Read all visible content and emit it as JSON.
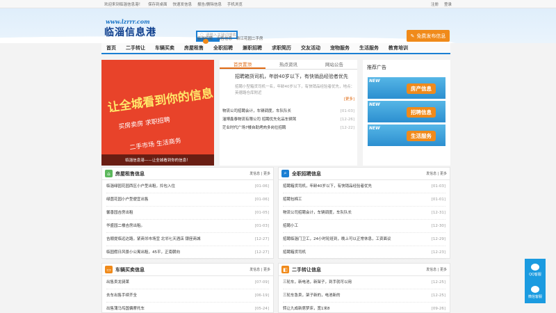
{
  "topbar": {
    "welcome": "欢迎来到临淄信息港！",
    "links": [
      "保存到桌面",
      "快速发信息",
      "报告/删除信息",
      "手机浏览"
    ],
    "right": [
      "注册",
      "登录"
    ]
  },
  "logo": {
    "url": "www.lzrrr.com",
    "name": "临淄信息港"
  },
  "search": {
    "placeholder": "请输入关键词搜索",
    "button": "搜索"
  },
  "hotlinks": [
    "临淄招聘",
    "出售信息",
    "新江花园二手房"
  ],
  "post_button": "免费发布信息",
  "nav": [
    "首页",
    "二手转让",
    "车辆买卖",
    "房屋租售",
    "全职招聘",
    "兼职招聘",
    "求职简历",
    "交友活动",
    "宠物服务",
    "生活服务",
    "教育培训"
  ],
  "banner": {
    "big": "让全城看到你的信息",
    "line1": "买房卖房  求职招聘",
    "line2": "二手市场  生活商务",
    "caption": "临淄信息港——让全城看到你的信息！"
  },
  "center": {
    "tabs": [
      "首页置顶",
      "热点资讯",
      "网站公告"
    ],
    "lead_title": "招聘箱货司机，年龄40岁以下，有快销品经验者优先",
    "lead_desc": "招聘小型箱货司机一名，年龄40岁以下，有快销品经验者优先，地点：英德路仓库附近",
    "more": "[更多]",
    "list": [
      {
        "title": "物流公司招聘会计，车辆调度，车队队长",
        "date": "[01-03]"
      },
      {
        "title": "淄博鑫泰物流有限公司 招聘优先化品车辆驾",
        "date": "[12-26]"
      },
      {
        "title": "茫业时代广场7楼自助烤肉多岗位招聘",
        "date": "[12-22]"
      }
    ]
  },
  "ad": {
    "title": "推荐广告",
    "items": [
      "房产信息",
      "招聘信息",
      "生活服务"
    ],
    "new": "NEW"
  },
  "boxes": {
    "house": {
      "title": "房屋租售信息",
      "more": "发信息 | 更多",
      "items": [
        {
          "t": "临淄绿园花园西区小户型出租，拎包入住",
          "d": "[01-06]"
        },
        {
          "t": "绿茵花园小户型便宜出售",
          "d": "[01-06]"
        },
        {
          "t": "馨香园吉房出租",
          "d": "[01-05]"
        },
        {
          "t": "华盛园二楼吉房出租。",
          "d": "[01-03]"
        },
        {
          "t": "吉顺提临远达路，紧商邻市场宜 北邻七天酒店 银座商城",
          "d": "[12-27]"
        },
        {
          "t": "临园假日风景小公寓出租，45平，正南朝向",
          "d": "[12-27]"
        }
      ]
    },
    "job": {
      "title": "全职招聘信息",
      "more": "发信息 | 更多",
      "items": [
        {
          "t": "招聘箱货司机，年龄40岁以下，有快销品经验者优先",
          "d": "[01-03]"
        },
        {
          "t": "招聘包棉工",
          "d": "[01-01]"
        },
        {
          "t": "物流公司招聘会计，车辆调度，车队队长",
          "d": "[12-31]"
        },
        {
          "t": "招聘小工",
          "d": "[12-30]"
        },
        {
          "t": "招聘临淄门卫工，24小时轮班到，晚上可以正常休息，工资面议",
          "d": "[12-29]"
        },
        {
          "t": "招聘箱货司机",
          "d": "[12-23]"
        }
      ]
    },
    "car": {
      "title": "车辆买卖信息",
      "more": "发信息 | 更多",
      "items": [
        {
          "t": "出售卖龙骑莱",
          "d": "[07-09]"
        },
        {
          "t": "去车出售手续齐全",
          "d": "[06-19]"
        },
        {
          "t": "出售蒲马坞国偏摩托车",
          "d": "[05-24]"
        }
      ]
    },
    "second": {
      "title": "二手转让信息",
      "more": "发信息 | 更多",
      "items": [
        {
          "t": "三轮车，新电池，新架子，到手就可以用",
          "d": "[12-25]"
        },
        {
          "t": "三轮车急卖，架子新的，电池新的",
          "d": "[12-25]"
        },
        {
          "t": "转让九成新席梦床，宽1米8",
          "d": "[09-26]"
        }
      ]
    }
  },
  "side": [
    "QQ客服",
    "微信客服"
  ],
  "colors": {
    "blue": "#1b7fd3",
    "orange": "#f08a1a",
    "green": "#5cb85c"
  }
}
